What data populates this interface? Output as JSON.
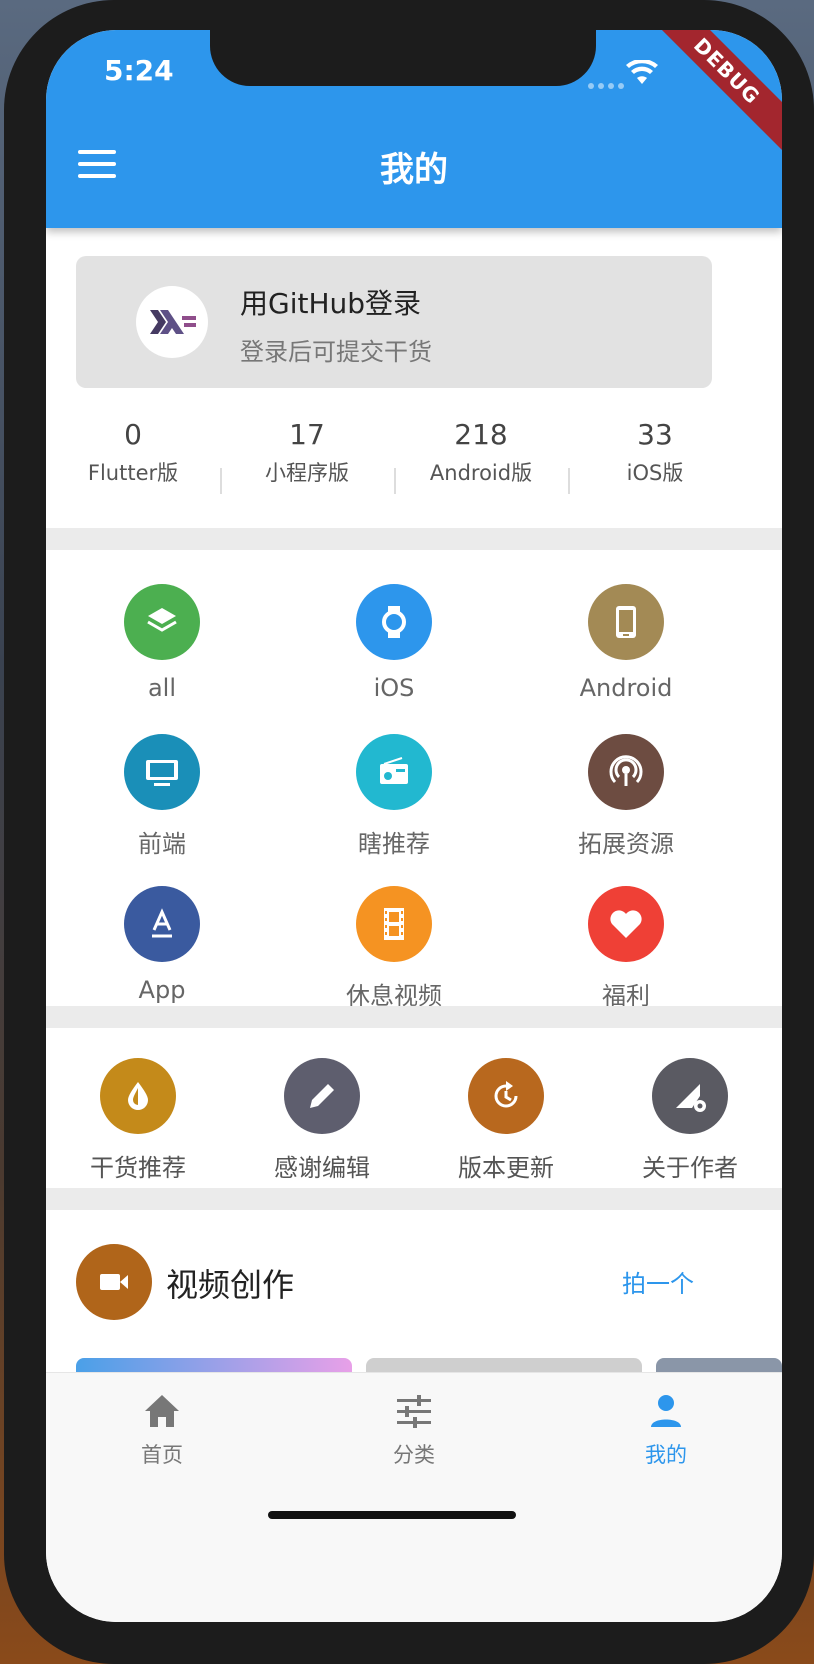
{
  "status_bar": {
    "time": "5:24",
    "debug_label": "DEBUG"
  },
  "app_bar": {
    "title": "我的"
  },
  "login": {
    "title": "用GitHub登录",
    "subtitle": "登录后可提交干货"
  },
  "stats": [
    {
      "value": "0",
      "label": "Flutter版"
    },
    {
      "value": "17",
      "label": "小程序版"
    },
    {
      "value": "218",
      "label": "Android版"
    },
    {
      "value": "33",
      "label": "iOS版"
    }
  ],
  "categories": [
    {
      "label": "all",
      "icon": "layers-icon",
      "color": "#4caf50"
    },
    {
      "label": "iOS",
      "icon": "watch-icon",
      "color": "#2d96ec"
    },
    {
      "label": "Android",
      "icon": "tablet-icon",
      "color": "#a38a55"
    },
    {
      "label": "前端",
      "icon": "monitor-icon",
      "color": "#1a8fb8"
    },
    {
      "label": "瞎推荐",
      "icon": "radio-icon",
      "color": "#22b8d0"
    },
    {
      "label": "拓展资源",
      "icon": "broadcast-icon",
      "color": "#6d4c41"
    },
    {
      "label": "App",
      "icon": "app-store-icon",
      "color": "#3a5a9f"
    },
    {
      "label": "休息视频",
      "icon": "film-icon",
      "color": "#f59322"
    },
    {
      "label": "福利",
      "icon": "heart-icon",
      "color": "#ef4036"
    }
  ],
  "actions": [
    {
      "label": "干货推荐",
      "icon": "drop-icon",
      "color": "#c48a1a"
    },
    {
      "label": "感谢编辑",
      "icon": "pencil-icon",
      "color": "#5e5e6e"
    },
    {
      "label": "版本更新",
      "icon": "update-icon",
      "color": "#b8681e"
    },
    {
      "label": "关于作者",
      "icon": "signal-settings-icon",
      "color": "#5a5a62"
    }
  ],
  "video": {
    "title": "视频创作",
    "action": "拍一个"
  },
  "tabs": [
    {
      "label": "首页",
      "icon": "home-icon",
      "active": false
    },
    {
      "label": "分类",
      "icon": "tune-icon",
      "active": false
    },
    {
      "label": "我的",
      "icon": "person-icon",
      "active": true
    }
  ],
  "colors": {
    "primary": "#2d96ec",
    "inactive": "#777777"
  }
}
